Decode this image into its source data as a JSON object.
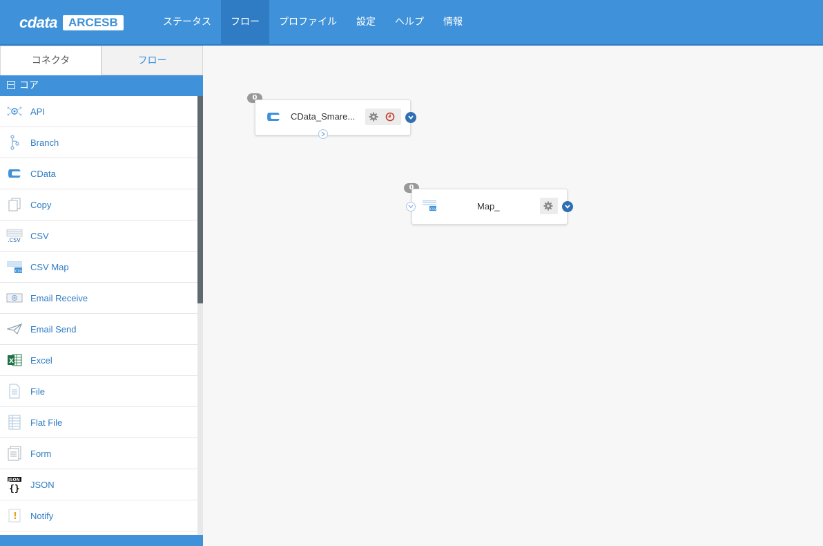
{
  "brand": {
    "logo_left": "cdata",
    "logo_right": "ARCESB"
  },
  "nav": [
    {
      "label": "ステータス"
    },
    {
      "label": "フロー"
    },
    {
      "label": "プロファイル"
    },
    {
      "label": "設定"
    },
    {
      "label": "ヘルプ"
    },
    {
      "label": "情報"
    }
  ],
  "nav_active": "フロー",
  "left_tabs": [
    {
      "label": "コネクタ"
    },
    {
      "label": "フロー"
    }
  ],
  "section": {
    "label": "コア"
  },
  "connectors": [
    {
      "label": "API",
      "icon": "api-icon"
    },
    {
      "label": "Branch",
      "icon": "branch-icon"
    },
    {
      "label": "CData",
      "icon": "cdata-icon"
    },
    {
      "label": "Copy",
      "icon": "copy-icon"
    },
    {
      "label": "CSV",
      "icon": "csv-icon"
    },
    {
      "label": "CSV Map",
      "icon": "csv-map-icon"
    },
    {
      "label": "Email Receive",
      "icon": "email-receive-icon"
    },
    {
      "label": "Email Send",
      "icon": "email-send-icon"
    },
    {
      "label": "Excel",
      "icon": "excel-icon"
    },
    {
      "label": "File",
      "icon": "file-icon"
    },
    {
      "label": "Flat File",
      "icon": "flat-file-icon"
    },
    {
      "label": "Form",
      "icon": "form-icon"
    },
    {
      "label": "JSON",
      "icon": "json-icon"
    },
    {
      "label": "Notify",
      "icon": "notify-icon"
    }
  ],
  "canvas": {
    "nodes": [
      {
        "badge": "0",
        "title": "CData_Smare...",
        "icon": "cdata-icon",
        "buttons": [
          "gear-icon",
          "clock-icon"
        ]
      },
      {
        "badge": "0",
        "title": "Map_",
        "icon": "csv-map-icon",
        "buttons": [
          "gear-icon"
        ]
      }
    ]
  },
  "colors": {
    "primary": "#3f91d9",
    "nav_active": "#2f7cc4",
    "port": "#2f6fb3",
    "alert": "#c0392b"
  }
}
